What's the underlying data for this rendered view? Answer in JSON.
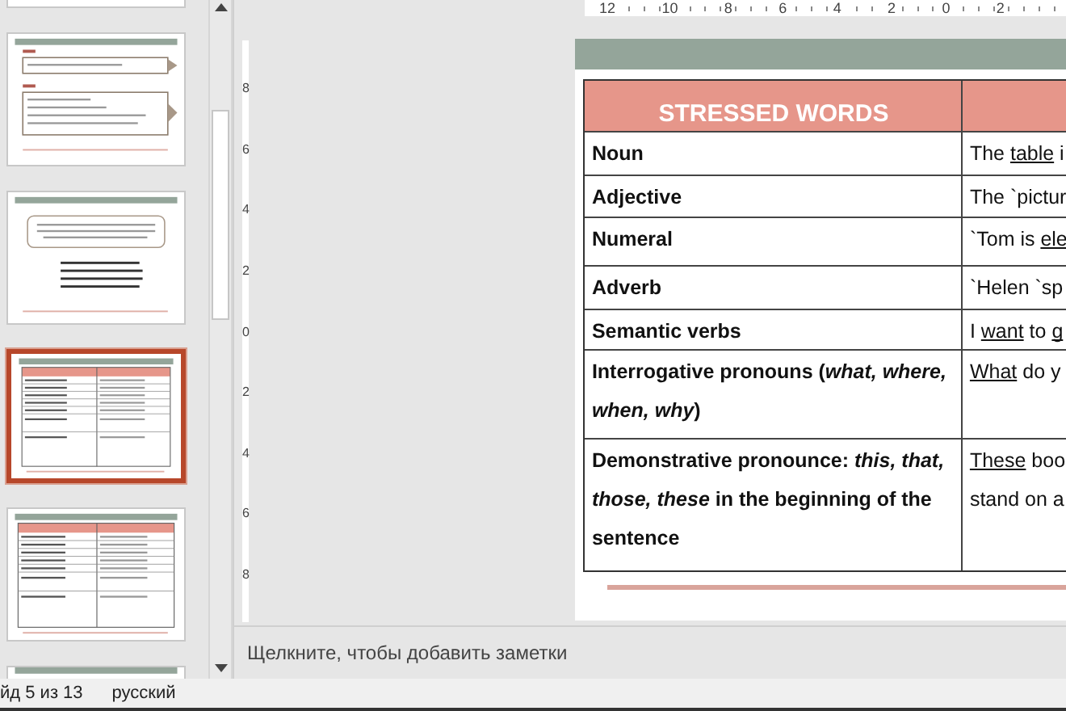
{
  "thumbnails": [
    {
      "kind": "partial",
      "selected": false
    },
    {
      "kind": "aim-tasks",
      "selected": false
    },
    {
      "kind": "text-verse",
      "selected": false
    },
    {
      "kind": "table",
      "selected": true
    },
    {
      "kind": "table",
      "selected": false
    },
    {
      "kind": "partial",
      "selected": false
    }
  ],
  "horizontal_ruler": [
    "12",
    "10",
    "8",
    "6",
    "4",
    "2",
    "0",
    "2"
  ],
  "vertical_ruler": [
    "8",
    "6",
    "4",
    "2",
    "0",
    "2",
    "4",
    "6",
    "8"
  ],
  "slide": {
    "table": {
      "columns": [
        "STRESSED WORDS",
        ""
      ],
      "rows": [
        {
          "word": "Noun",
          "example": [
            [
              {
                "text": "The "
              },
              {
                "text": "table",
                "underline": true
              },
              {
                "text": " i"
              }
            ]
          ]
        },
        {
          "word": "Adjective",
          "example": [
            [
              {
                "text": "The `pictur"
              }
            ]
          ]
        },
        {
          "word": "Numeral",
          "example": [
            [
              {
                "text": "`Tom is "
              },
              {
                "text": "ele",
                "underline": true
              }
            ]
          ]
        },
        {
          "word": "Adverb",
          "example": [
            [
              {
                "text": "`Helen `sp"
              }
            ]
          ]
        },
        {
          "word": "Semantic verbs",
          "example": [
            [
              {
                "text": "I "
              },
              {
                "text": "want",
                "underline": true
              },
              {
                "text": " to "
              },
              {
                "text": "g",
                "underline": true
              }
            ]
          ]
        },
        {
          "word": "Interrogative pronouns (*what, where, when, why*)",
          "example": [
            [
              {
                "text": "What",
                "underline": true
              },
              {
                "text": " do y"
              }
            ]
          ]
        },
        {
          "word": "Demonstrative pronounce: *this, that, those, these* in the beginning of the sentence",
          "example": [
            [
              {
                "text": "These",
                "underline": true
              },
              {
                "text": " boo"
              }
            ],
            [
              {
                "text": "stand on a"
              }
            ]
          ]
        }
      ]
    }
  },
  "notes": {
    "placeholder": "Щелкните, чтобы добавить заметки"
  },
  "status_bar": {
    "slide_counter": "йд 5 из 13",
    "language": "русский"
  }
}
